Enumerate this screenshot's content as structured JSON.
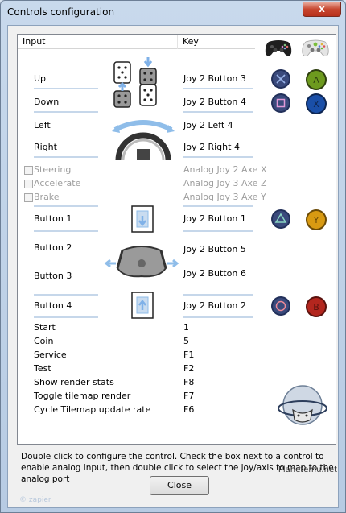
{
  "window": {
    "title": "Controls configuration",
    "close_glyph": "x"
  },
  "list": {
    "col_input": "Input",
    "col_key": "Key",
    "rows": [
      {
        "input": "Up",
        "key": "Joy 2 Button 3",
        "enabled": true
      },
      {
        "input": "Down",
        "key": "Joy 2 Button 4",
        "enabled": true
      },
      {
        "input": "Left",
        "key": "Joy 2 Left 4",
        "enabled": true
      },
      {
        "input": "Right",
        "key": "Joy 2 Right 4",
        "enabled": true
      },
      {
        "input": "Steering",
        "key": "Analog Joy 2 Axe X",
        "enabled": false,
        "checkbox": true,
        "checked": false
      },
      {
        "input": "Accelerate",
        "key": "Analog Joy 3 Axe Z",
        "enabled": false,
        "checkbox": true,
        "checked": false
      },
      {
        "input": "Brake",
        "key": "Analog Joy 3 Axe Y",
        "enabled": false,
        "checkbox": true,
        "checked": false
      },
      {
        "input": "Button 1",
        "key": "Joy 2 Button 1",
        "enabled": true
      },
      {
        "input": "Button 2",
        "key": "Joy 2 Button 5",
        "enabled": true
      },
      {
        "input": "Button 3",
        "key": "Joy 2 Button 6",
        "enabled": true
      },
      {
        "input": "Button 4",
        "key": "Joy 2 Button 2",
        "enabled": true
      },
      {
        "input": "Start",
        "key": "1",
        "enabled": true
      },
      {
        "input": "Coin",
        "key": "5",
        "enabled": true
      },
      {
        "input": "Service",
        "key": "F1",
        "enabled": true
      },
      {
        "input": "Test",
        "key": "F2",
        "enabled": true
      },
      {
        "input": "Show render stats",
        "key": "F8",
        "enabled": true
      },
      {
        "input": "Toggle tilemap render",
        "key": "F7",
        "enabled": true
      },
      {
        "input": "Cycle Tilemap update rate",
        "key": "F6",
        "enabled": true
      }
    ]
  },
  "hint_text": "Double click to configure the control. Check the box next to a control to enable analog input, then double click to select the joy/axis to map to the analog port",
  "close_button_label": "Close",
  "watermark_right": "Planetemu.net",
  "watermark_left": "© zapier",
  "logo_text": "PLANET EMULATION",
  "icons": {
    "ps_gamepad": "playstation-gamepad-icon",
    "xbox_gamepad": "xbox-gamepad-icon",
    "ps_cross": "ps-cross-button-icon",
    "ps_square": "ps-square-button-icon",
    "ps_triangle": "ps-triangle-button-icon",
    "ps_circle": "ps-circle-button-icon",
    "xbox_a": "xbox-a-button-icon",
    "xbox_x": "xbox-x-button-icon",
    "xbox_y": "xbox-y-button-icon",
    "xbox_b": "xbox-b-button-icon"
  },
  "colors": {
    "xbox_a": "#6d9a1e",
    "xbox_x": "#1a4fa8",
    "xbox_y": "#d89a12",
    "xbox_b": "#b3261e",
    "ps_bg": "#22305a"
  }
}
